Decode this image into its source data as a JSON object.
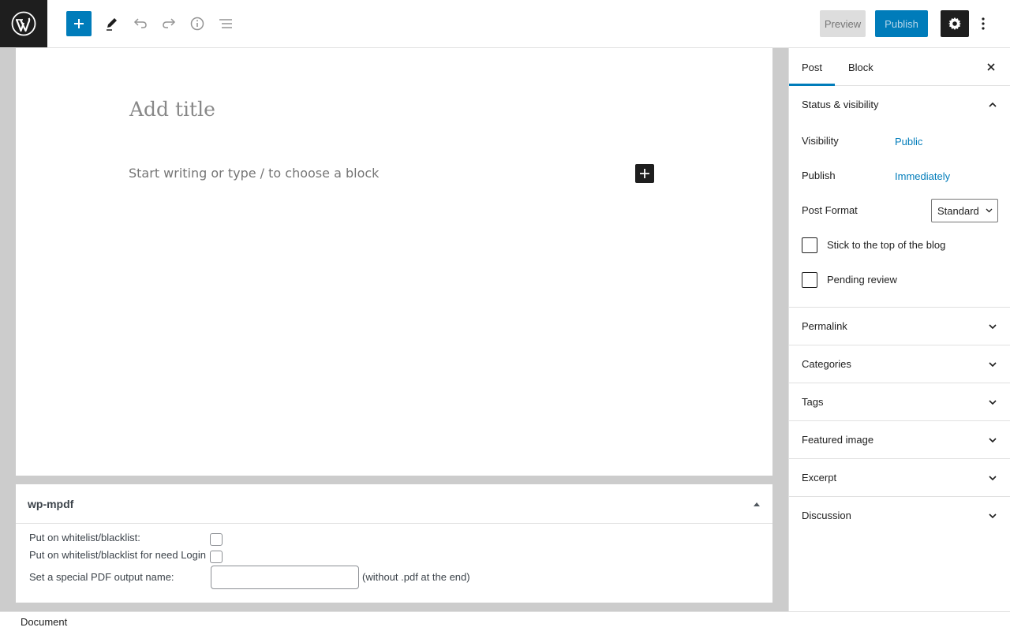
{
  "toolbar": {
    "logo_icon": "wordpress-icon",
    "inserter_icon": "plus-icon",
    "tools_icon": "pencil-icon",
    "undo_icon": "undo-icon",
    "redo_icon": "redo-icon",
    "info_icon": "info-icon",
    "outline_icon": "list-view-icon",
    "preview_label": "Preview",
    "publish_label": "Publish",
    "settings_icon": "gear-icon",
    "more_icon": "more-vertical-icon"
  },
  "editor": {
    "title_placeholder": "Add title",
    "block_placeholder": "Start writing or type / to choose a block"
  },
  "metabox": {
    "title": "wp-mpdf",
    "row1_label": "Put on whitelist/blacklist:",
    "row2_label": "Put on whitelist/blacklist for need Login",
    "row3_label": "Set a special PDF output name:",
    "row3_hint": "(without .pdf at the end)",
    "row3_value": ""
  },
  "footer": {
    "breadcrumb": "Document"
  },
  "sidebar": {
    "tabs": [
      {
        "label": "Post",
        "active": true
      },
      {
        "label": "Block",
        "active": false
      }
    ],
    "status_panel": {
      "title": "Status & visibility",
      "visibility_label": "Visibility",
      "visibility_value": "Public",
      "publish_label": "Publish",
      "publish_value": "Immediately",
      "format_label": "Post Format",
      "format_value": "Standard",
      "sticky_label": "Stick to the top of the blog",
      "pending_label": "Pending review"
    },
    "panels": [
      {
        "label": "Permalink"
      },
      {
        "label": "Categories"
      },
      {
        "label": "Tags"
      },
      {
        "label": "Featured image"
      },
      {
        "label": "Excerpt"
      },
      {
        "label": "Discussion"
      }
    ]
  },
  "colors": {
    "accent": "#007cba",
    "dark": "#1e1e1e",
    "canvas_bg": "#cccccc"
  }
}
